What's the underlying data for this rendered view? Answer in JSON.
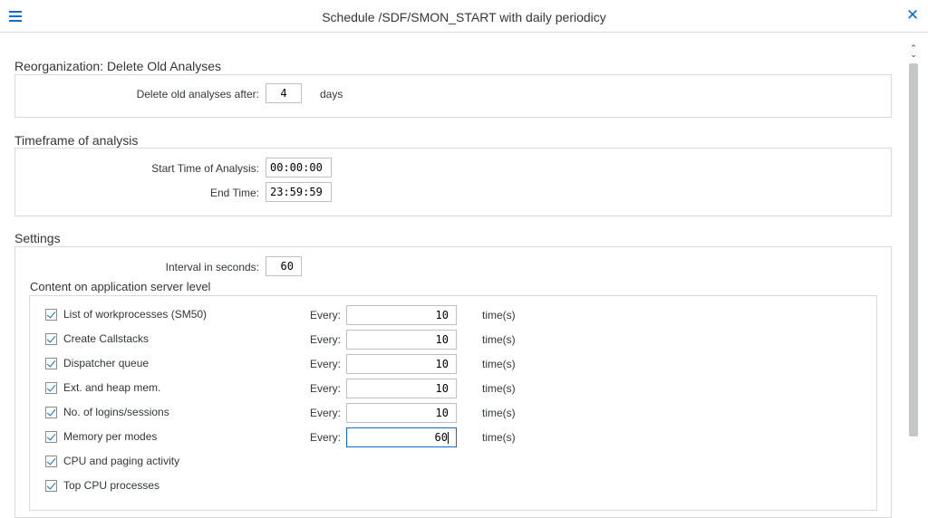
{
  "header": {
    "title": "Schedule /SDF/SMON_START with daily periodicy",
    "menu_icon": "hamburger-menu-icon",
    "close_icon": "close-icon"
  },
  "reorganization": {
    "title": "Reorganization: Delete Old Analyses",
    "label": "Delete old analyses after:",
    "value": "4",
    "unit": "days"
  },
  "timeframe": {
    "title": "Timeframe of analysis",
    "start_label": "Start Time of Analysis:",
    "start_value": "00:00:00",
    "end_label": "End Time:",
    "end_value": "23:59:59"
  },
  "settings": {
    "title": "Settings",
    "interval_label": "Interval in seconds:",
    "interval_value": "60",
    "content_title": "Content on application server level",
    "every_label": "Every:",
    "unit_label": "time(s)",
    "items": [
      {
        "label": "List of workprocesses (SM50)",
        "checked": true,
        "value": "10"
      },
      {
        "label": "Create Callstacks",
        "checked": true,
        "value": "10"
      },
      {
        "label": "Dispatcher queue",
        "checked": true,
        "value": "10"
      },
      {
        "label": "Ext. and heap mem.",
        "checked": true,
        "value": "10"
      },
      {
        "label": "No. of logins/sessions",
        "checked": true,
        "value": "10"
      },
      {
        "label": "Memory per modes",
        "checked": true,
        "value": "60"
      },
      {
        "label": "CPU and paging activity",
        "checked": true
      },
      {
        "label": "Top CPU processes",
        "checked": true
      }
    ]
  },
  "colors": {
    "accent": "#0a6ed1",
    "text": "#32363a",
    "border": "#d9d9d9"
  }
}
